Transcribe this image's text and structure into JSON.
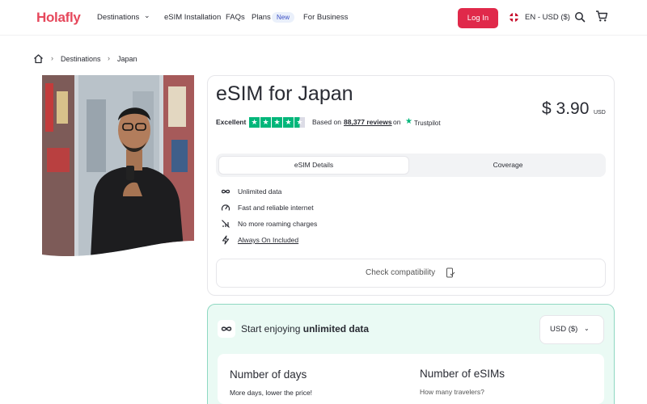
{
  "header": {
    "logo": "Holafly",
    "nav": {
      "destinations": "Destinations",
      "esim_installation": "eSIM Installation",
      "faqs": "FAQs",
      "plans": "Plans",
      "plans_badge": "New",
      "for_business": "For Business"
    },
    "login": "Log In",
    "language": "EN - USD ($)"
  },
  "breadcrumb": {
    "items": [
      "Destinations",
      "Japan"
    ]
  },
  "product": {
    "title": "eSIM for Japan",
    "price": "$ 3.90",
    "price_currency": "USD",
    "rating": {
      "label": "Excellent",
      "stars": 4.5,
      "based_on": "Based on",
      "reviews": "88,377 reviews",
      "on": "on",
      "provider": "Trustpilot"
    },
    "tabs": [
      "eSIM Details",
      "Coverage"
    ],
    "active_tab": "eSIM Details",
    "features": [
      {
        "label": "Unlimited data",
        "icon": "infinity-icon"
      },
      {
        "label": "Fast and reliable internet",
        "icon": "speedometer-icon"
      },
      {
        "label": "No more roaming charges",
        "icon": "no-signal-icon"
      },
      {
        "label": "Always On Included",
        "icon": "bolt-icon"
      }
    ],
    "check_compatibility": "Check compatibility"
  },
  "plan": {
    "headline_prefix": "Start enjoying",
    "headline_bold": "unlimited data",
    "currency": "USD ($)",
    "days_title": "Number of days",
    "days_subtitle": "More days, lower the price!",
    "esims_title": "Number of eSIMs",
    "esims_subtitle": "How many travelers?"
  },
  "colors": {
    "brand": "#E6485C",
    "login_button": "#E0294A",
    "trustpilot": "#00B67A",
    "plan_bg": "#EAFAF4",
    "plan_border": "#8FD8C2"
  }
}
